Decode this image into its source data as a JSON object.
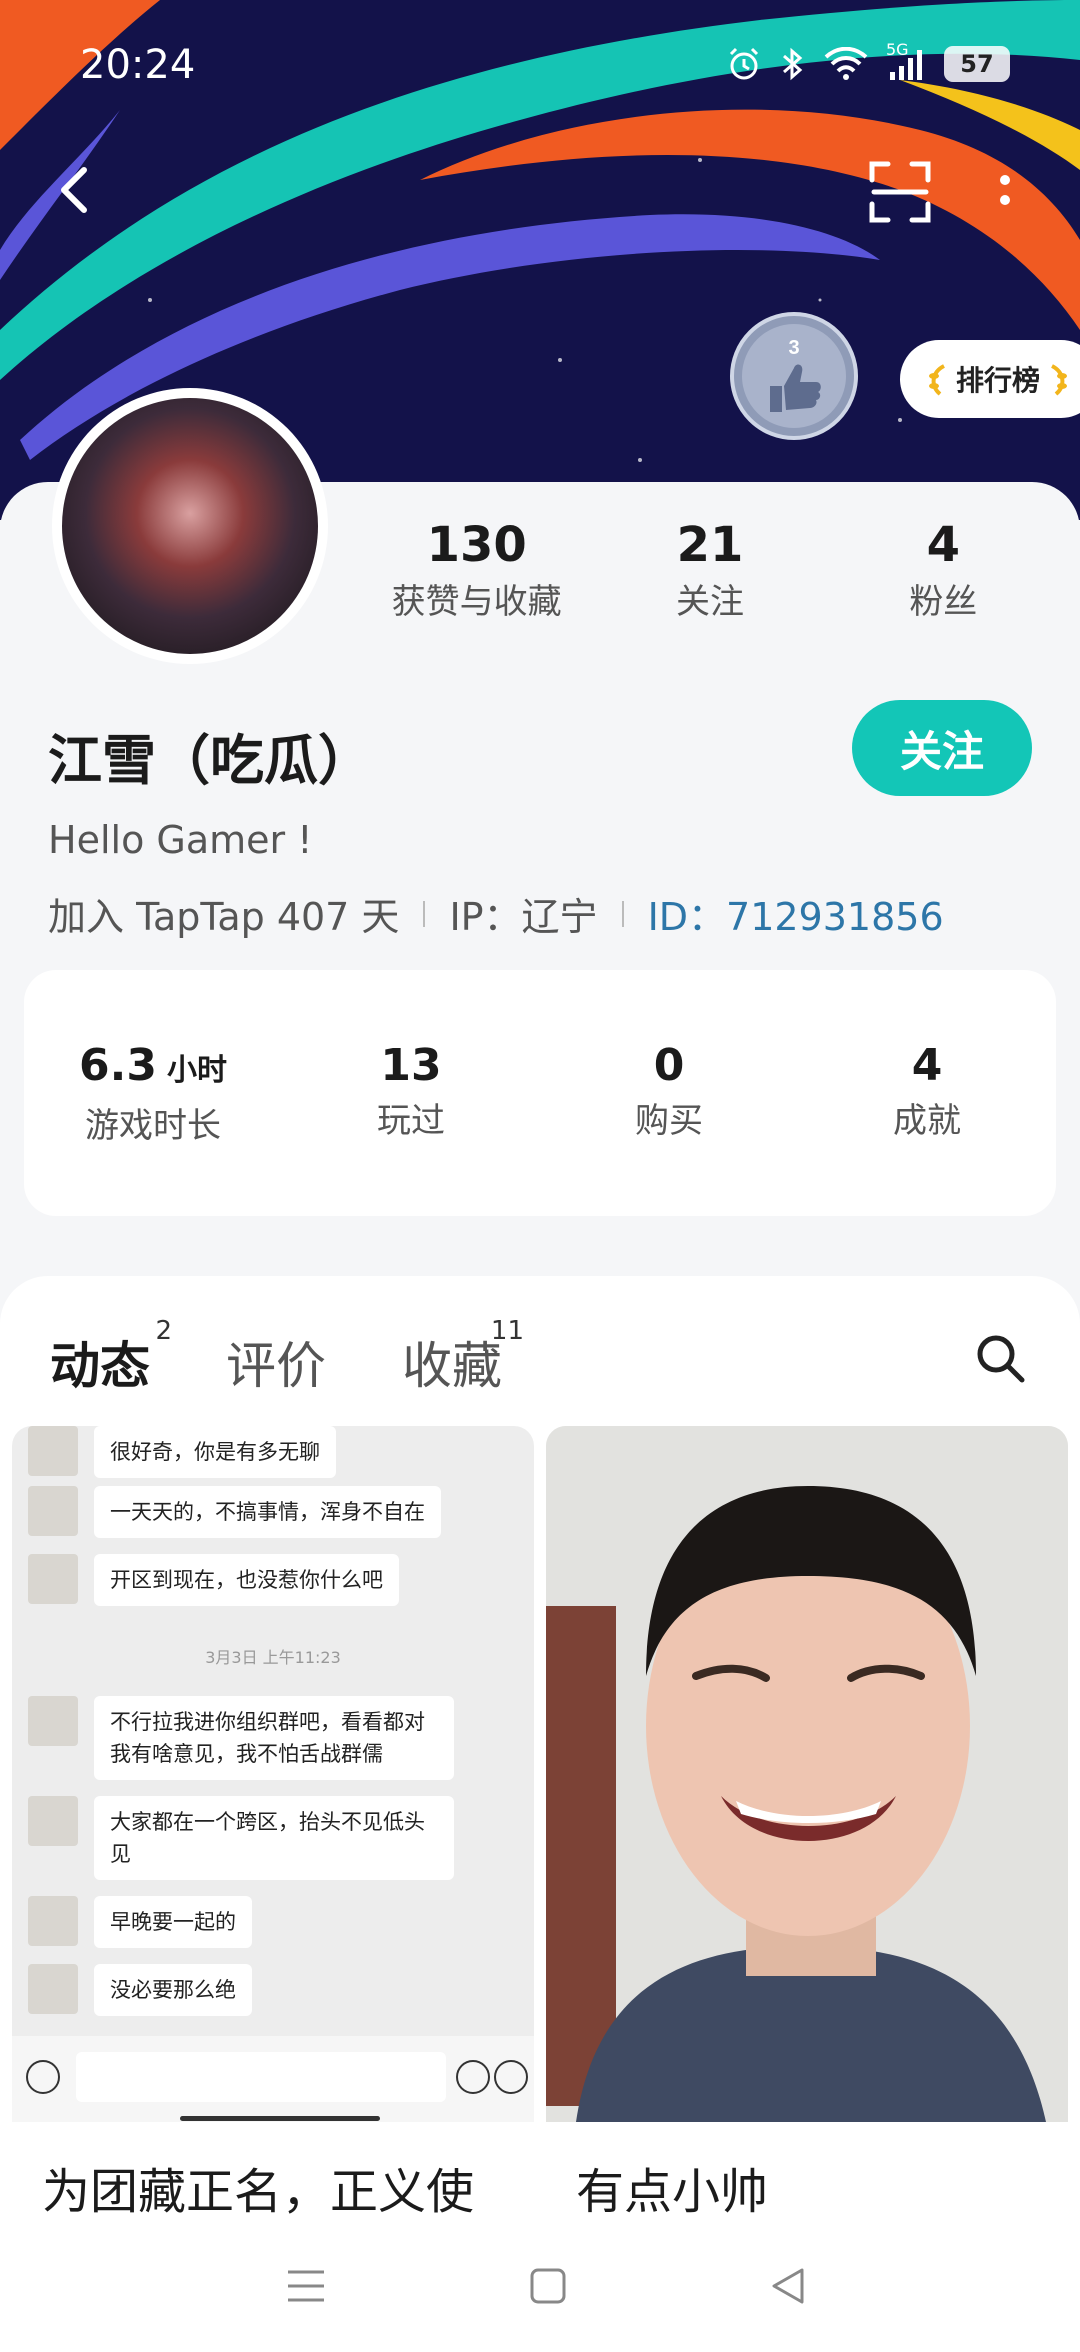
{
  "status_bar": {
    "time": "20:24",
    "network": "5G",
    "battery": "57"
  },
  "header": {
    "rank_label": "排行榜",
    "medal_text": "3"
  },
  "profile": {
    "stats": [
      {
        "value": "130",
        "label": "获赞与收藏"
      },
      {
        "value": "21",
        "label": "关注"
      },
      {
        "value": "4",
        "label": "粉丝"
      }
    ],
    "username": "江雪（吃瓜）",
    "follow_label": "关注",
    "bio": "Hello Gamer !",
    "join_text": "加入 TapTap 407 天",
    "ip_text": "IP：辽宁",
    "id_text": "ID：712931856"
  },
  "game_stats": [
    {
      "value": "6.3",
      "unit": "小时",
      "label": "游戏时长"
    },
    {
      "value": "13",
      "unit": "",
      "label": "玩过"
    },
    {
      "value": "0",
      "unit": "",
      "label": "购买"
    },
    {
      "value": "4",
      "unit": "",
      "label": "成就"
    }
  ],
  "tabs": [
    {
      "label": "动态",
      "count": "2"
    },
    {
      "label": "评价",
      "count": ""
    },
    {
      "label": "收藏",
      "count": "11"
    }
  ],
  "posts": [
    {
      "title": "为团藏正名，正义使",
      "chat": {
        "messages": [
          "很好奇，你是有多无聊",
          "一天天的，不搞事情，浑身不自在",
          "开区到现在，也没惹你什么吧",
          "不行拉我进你组织群吧，看看都对我有啥意见，我不怕舌战群儒",
          "大家都在一个跨区，抬头不见低头见",
          "早晚要一起的",
          "没必要那么绝"
        ],
        "timestamp": "3月3日 上午11:23"
      }
    },
    {
      "title": "有点小帅"
    }
  ],
  "colors": {
    "accent": "#13c6b7",
    "banner_bg": "#13124a",
    "id_blue": "#2d76a8"
  }
}
